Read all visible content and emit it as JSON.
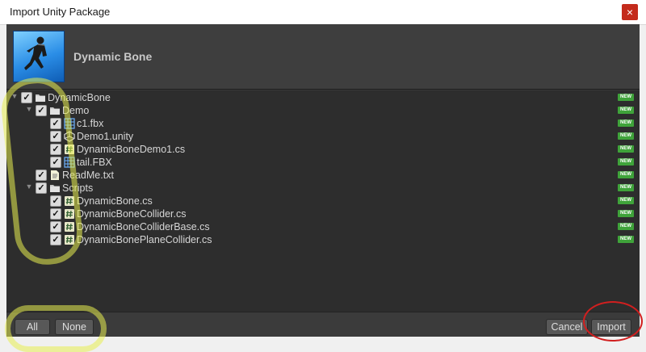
{
  "window": {
    "title": "Import Unity Package",
    "close_glyph": "×"
  },
  "package": {
    "name": "Dynamic Bone"
  },
  "tree": {
    "new_badge": "NEW",
    "items": [
      {
        "label": "DynamicBone",
        "icon": "folder-icon",
        "checked": true,
        "foldout": "expanded"
      },
      {
        "label": "Demo",
        "icon": "folder-icon",
        "checked": true,
        "foldout": "expanded"
      },
      {
        "label": "c1.fbx",
        "icon": "model-icon",
        "checked": true
      },
      {
        "label": "Demo1.unity",
        "icon": "unity-scene-icon",
        "checked": true
      },
      {
        "label": "DynamicBoneDemo1.cs",
        "icon": "script-icon",
        "checked": true
      },
      {
        "label": "tail.FBX",
        "icon": "model-icon",
        "checked": true
      },
      {
        "label": "ReadMe.txt",
        "icon": "text-file-icon",
        "checked": true
      },
      {
        "label": "Scripts",
        "icon": "folder-icon",
        "checked": true,
        "foldout": "expanded"
      },
      {
        "label": "DynamicBone.cs",
        "icon": "script-icon",
        "checked": true
      },
      {
        "label": "DynamicBoneCollider.cs",
        "icon": "script-icon",
        "checked": true
      },
      {
        "label": "DynamicBoneColliderBase.cs",
        "icon": "script-icon",
        "checked": true
      },
      {
        "label": "DynamicBonePlaneCollider.cs",
        "icon": "script-icon",
        "checked": true
      }
    ]
  },
  "footer": {
    "all_label": "All",
    "none_label": "None",
    "cancel_label": "Cancel",
    "import_label": "Import"
  },
  "colors": {
    "badge_green": "#3fa33a",
    "highlight_yellow": "#e8ee50",
    "annotation_red": "#d11f1f"
  }
}
